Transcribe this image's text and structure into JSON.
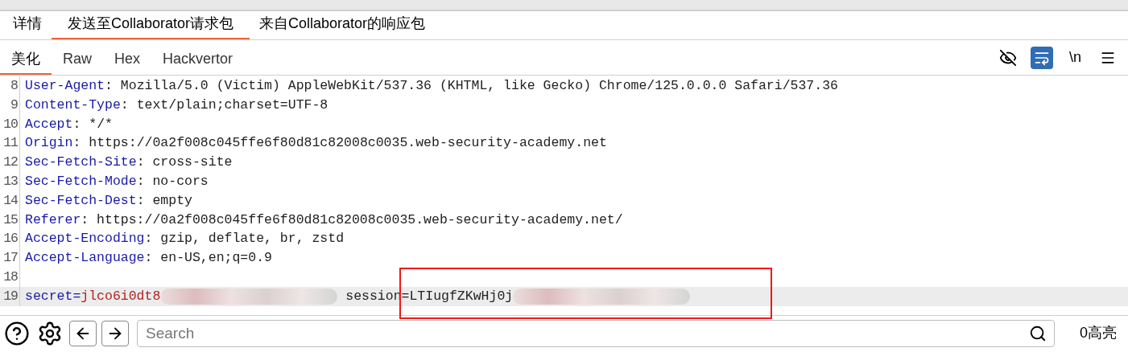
{
  "message_tabs": [
    {
      "label": "详情",
      "selected": false
    },
    {
      "label": "发送至Collaborator请求包",
      "selected": true
    },
    {
      "label": "来自Collaborator的响应包",
      "selected": false
    }
  ],
  "view_tabs": [
    {
      "label": "美化",
      "selected": true
    },
    {
      "label": "Raw",
      "selected": false
    },
    {
      "label": "Hex",
      "selected": false
    },
    {
      "label": "Hackvertor",
      "selected": false
    }
  ],
  "toolbar": {
    "hide_toggle_on": false,
    "wrap_toggle_on": true,
    "newline_label": "\\n"
  },
  "lines": [
    {
      "number": "8",
      "selected": false,
      "parts": [
        {
          "kind": "name",
          "text": "User-Agent"
        },
        {
          "kind": "plain",
          "text": ": Mozilla/5.0 (Victim) AppleWebKit/537.36 (KHTML, like Gecko) Chrome/125.0.0.0 Safari/537.36"
        }
      ]
    },
    {
      "number": "9",
      "selected": false,
      "parts": [
        {
          "kind": "name",
          "text": "Content-Type"
        },
        {
          "kind": "plain",
          "text": ": text/plain;charset=UTF-8"
        }
      ]
    },
    {
      "number": "10",
      "selected": false,
      "parts": [
        {
          "kind": "name",
          "text": "Accept"
        },
        {
          "kind": "plain",
          "text": ": */*"
        }
      ]
    },
    {
      "number": "11",
      "selected": false,
      "parts": [
        {
          "kind": "name",
          "text": "Origin"
        },
        {
          "kind": "plain",
          "text": ": https://0a2f008c045ffe6f80d81c82008c0035.web-security-academy.net"
        }
      ]
    },
    {
      "number": "12",
      "selected": false,
      "parts": [
        {
          "kind": "name",
          "text": "Sec-Fetch-Site"
        },
        {
          "kind": "plain",
          "text": ": cross-site"
        }
      ]
    },
    {
      "number": "13",
      "selected": false,
      "parts": [
        {
          "kind": "name",
          "text": "Sec-Fetch-Mode"
        },
        {
          "kind": "plain",
          "text": ": no-cors"
        }
      ]
    },
    {
      "number": "14",
      "selected": false,
      "parts": [
        {
          "kind": "name",
          "text": "Sec-Fetch-Dest"
        },
        {
          "kind": "plain",
          "text": ": empty"
        }
      ]
    },
    {
      "number": "15",
      "selected": false,
      "parts": [
        {
          "kind": "name",
          "text": "Referer"
        },
        {
          "kind": "plain",
          "text": ": https://0a2f008c045ffe6f80d81c82008c0035.web-security-academy.net/"
        }
      ]
    },
    {
      "number": "16",
      "selected": false,
      "parts": [
        {
          "kind": "name",
          "text": "Accept-Encoding"
        },
        {
          "kind": "plain",
          "text": ": gzip, deflate, br, zstd"
        }
      ]
    },
    {
      "number": "17",
      "selected": false,
      "parts": [
        {
          "kind": "name",
          "text": "Accept-Language"
        },
        {
          "kind": "plain",
          "text": ": en-US,en;q=0.9"
        }
      ]
    },
    {
      "number": "18",
      "selected": false
    },
    {
      "number": "19",
      "selected": true,
      "parts": [
        {
          "kind": "name",
          "text": "secret="
        },
        {
          "kind": "param",
          "text": "jlco6i0dt8"
        },
        {
          "kind": "redacted"
        },
        {
          "kind": "plain",
          "text": " session=LTIugfZKwHj0j"
        },
        {
          "kind": "redacted"
        }
      ]
    }
  ],
  "search": {
    "placeholder": "Search"
  },
  "highlights": "0高亮"
}
